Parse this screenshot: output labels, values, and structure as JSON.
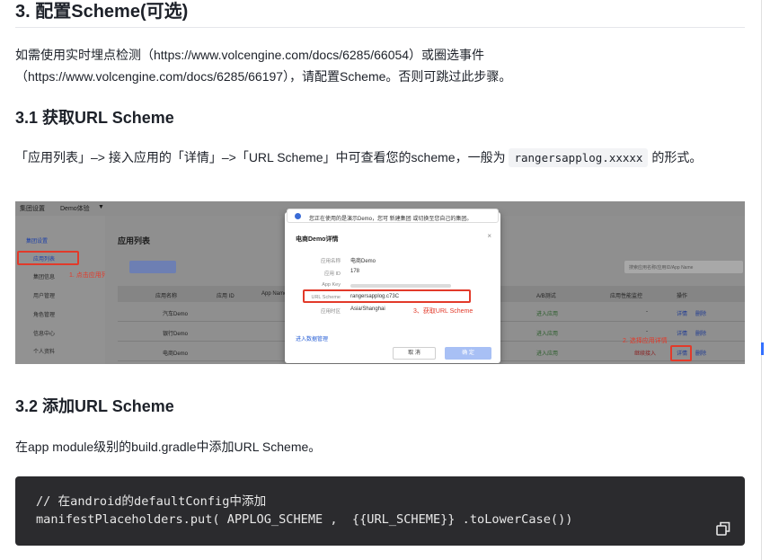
{
  "section": {
    "title": "3. 配置Scheme(可选)",
    "intro_line1": "如需使用实时埋点检测（https://www.volcengine.com/docs/6285/66054）或圈选事件",
    "intro_line2": "（https://www.volcengine.com/docs/6285/66197），请配置Scheme。否则可跳过此步骤。"
  },
  "sub1": {
    "title": "3.1 获取URL Scheme",
    "text_before": "「应用列表」–> 接入应用的「详情」–>「URL Scheme」中可查看您的scheme，一般为 ",
    "code": "rangersapplog.xxxxx",
    "text_after": " 的形式。"
  },
  "screenshot": {
    "topbar": {
      "org": "集团设置",
      "demo": "Demo体验",
      "caret": "▼"
    },
    "sidebar": [
      {
        "label": "集团设置",
        "active": true
      },
      {
        "label": "应用列表",
        "active": true
      },
      {
        "label": "集团信息",
        "active": false
      },
      {
        "label": "用户管理",
        "active": false
      },
      {
        "label": "角色管理",
        "active": false
      },
      {
        "label": "信息中心",
        "active": false
      },
      {
        "label": "个人资料",
        "active": false
      }
    ],
    "step1": "1. 点击应用列表",
    "step2": "2. 选择应用详情",
    "step3": "3、获取URL Scheme",
    "page_title": "应用列表",
    "search_placeholder": "搜索应用名称/应用ID/App Name",
    "columns": [
      "应用名称",
      "应用 ID",
      "App Name",
      "A/B测试",
      "应用性能监控",
      "操作"
    ],
    "rows": [
      {
        "name": "汽车Demo",
        "ab": "进入应用",
        "apm": "-",
        "detail": "详情",
        "del": "删除"
      },
      {
        "name": "银行Demo",
        "ab": "进入应用",
        "apm": "-",
        "detail": "详情",
        "del": "删除"
      },
      {
        "name": "电商Demo",
        "ab": "进入应用",
        "apm": "继续接入",
        "detail": "详情",
        "del": "删除"
      }
    ],
    "modal": {
      "tip": "您正在使用的是演示Demo，您可 新建集团 或切换至您自己的集团。",
      "title": "电商Demo详情",
      "close": "×",
      "fields": [
        {
          "label": "应用名称",
          "value": "电商Demo"
        },
        {
          "label": "应用 ID",
          "value": "178"
        },
        {
          "label": "App Key",
          "value": ""
        },
        {
          "label": "URL Scheme",
          "value": "rangersapplog.c73C"
        },
        {
          "label": "应用时区",
          "value": "Asia/Shanghai"
        }
      ],
      "enter": "进入数据管理",
      "cancel": "取 消",
      "ok": "确 定"
    }
  },
  "sub2": {
    "title": "3.2 添加URL Scheme",
    "text": "在app module级别的build.gradle中添加URL Scheme。"
  },
  "code_block": {
    "line1": "// 在android的defaultConfig中添加",
    "line2": "manifestPlaceholders.put( APPLOG_SCHEME ,  {{URL_SCHEME}} .toLowerCase())",
    "copy_icon": "copy-icon"
  },
  "colors": {
    "heading": "#1d2129",
    "code_bg": "#2b2b2e",
    "accent": "#3370ff",
    "annotation_red": "#e23a2a"
  }
}
